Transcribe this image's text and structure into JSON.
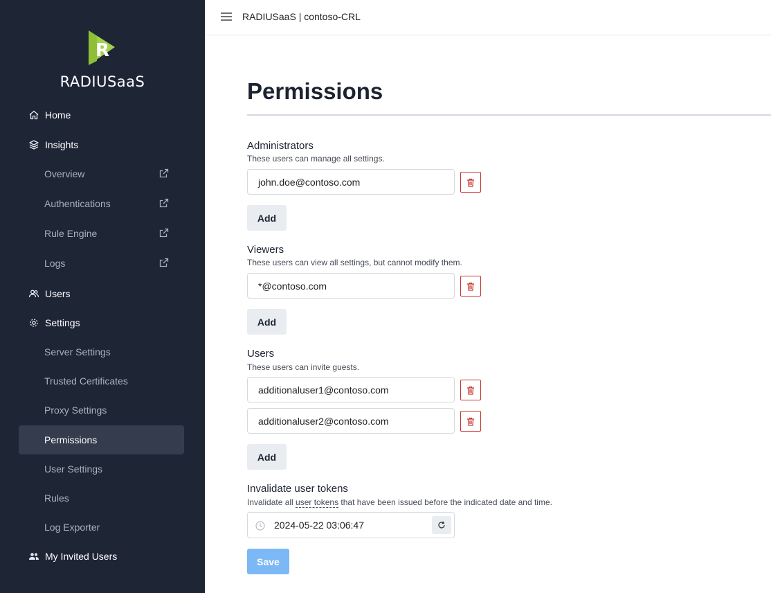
{
  "app": {
    "brand": "RADIUSaaS",
    "header_title": "RADIUSaaS | contoso-CRL"
  },
  "colors": {
    "sidebar_bg": "#1e2535",
    "logo_green": "#a4d14c",
    "delete_red": "#c8342e",
    "save_blue": "#7cb8f5"
  },
  "sidebar": {
    "items": [
      {
        "label": "Home",
        "icon": "home-icon"
      },
      {
        "label": "Insights",
        "icon": "layers-icon"
      },
      {
        "label": "Overview",
        "icon": "external-link-icon"
      },
      {
        "label": "Authentications",
        "icon": "external-link-icon"
      },
      {
        "label": "Rule Engine",
        "icon": "external-link-icon"
      },
      {
        "label": "Logs",
        "icon": "external-link-icon"
      },
      {
        "label": "Users",
        "icon": "users-icon"
      },
      {
        "label": "Settings",
        "icon": "gear-icon"
      },
      {
        "label": "Server Settings"
      },
      {
        "label": "Trusted Certificates"
      },
      {
        "label": "Proxy Settings"
      },
      {
        "label": "Permissions",
        "active": true
      },
      {
        "label": "User Settings"
      },
      {
        "label": "Rules"
      },
      {
        "label": "Log Exporter"
      },
      {
        "label": "My Invited Users",
        "icon": "people-icon"
      }
    ]
  },
  "page": {
    "title": "Permissions"
  },
  "administrators": {
    "title": "Administrators",
    "description": "These users can manage all settings.",
    "entries": [
      "john.doe@contoso.com"
    ],
    "add_label": "Add"
  },
  "viewers": {
    "title": "Viewers",
    "description": "These users can view all settings, but cannot modify them.",
    "entries": [
      "*@contoso.com"
    ],
    "add_label": "Add"
  },
  "users": {
    "title": "Users",
    "description": "These users can invite guests.",
    "entries": [
      "additionaluser1@contoso.com",
      "additionaluser2@contoso.com"
    ],
    "add_label": "Add"
  },
  "tokens": {
    "title": "Invalidate user tokens",
    "desc_before": "Invalidate all ",
    "desc_link": "user tokens",
    "desc_after": " that have been issued before the indicated date and time.",
    "datetime": "2024-05-22 03:06:47"
  },
  "save_label": "Save"
}
